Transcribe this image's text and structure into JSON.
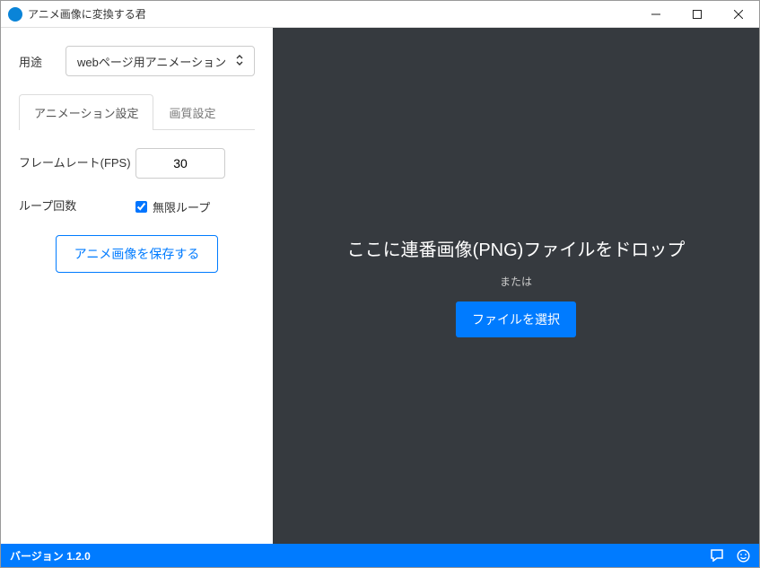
{
  "window": {
    "title": "アニメ画像に変換する君"
  },
  "left": {
    "purpose_label": "用途",
    "purpose_value": "webページ用アニメーション",
    "tabs": {
      "anim": "アニメーション設定",
      "quality": "画質設定"
    },
    "framerate_label": "フレームレート(FPS)",
    "framerate_value": "30",
    "loop_label": "ループ回数",
    "loop_check_label": "無限ループ",
    "loop_checked": true,
    "save_button": "アニメ画像を保存する"
  },
  "right": {
    "drop_message": "ここに連番画像(PNG)ファイルをドロップ",
    "or_label": "または",
    "select_button": "ファイルを選択"
  },
  "status": {
    "version": "バージョン 1.2.0"
  },
  "colors": {
    "primary": "#007bff",
    "dark_panel": "#363a3f"
  }
}
